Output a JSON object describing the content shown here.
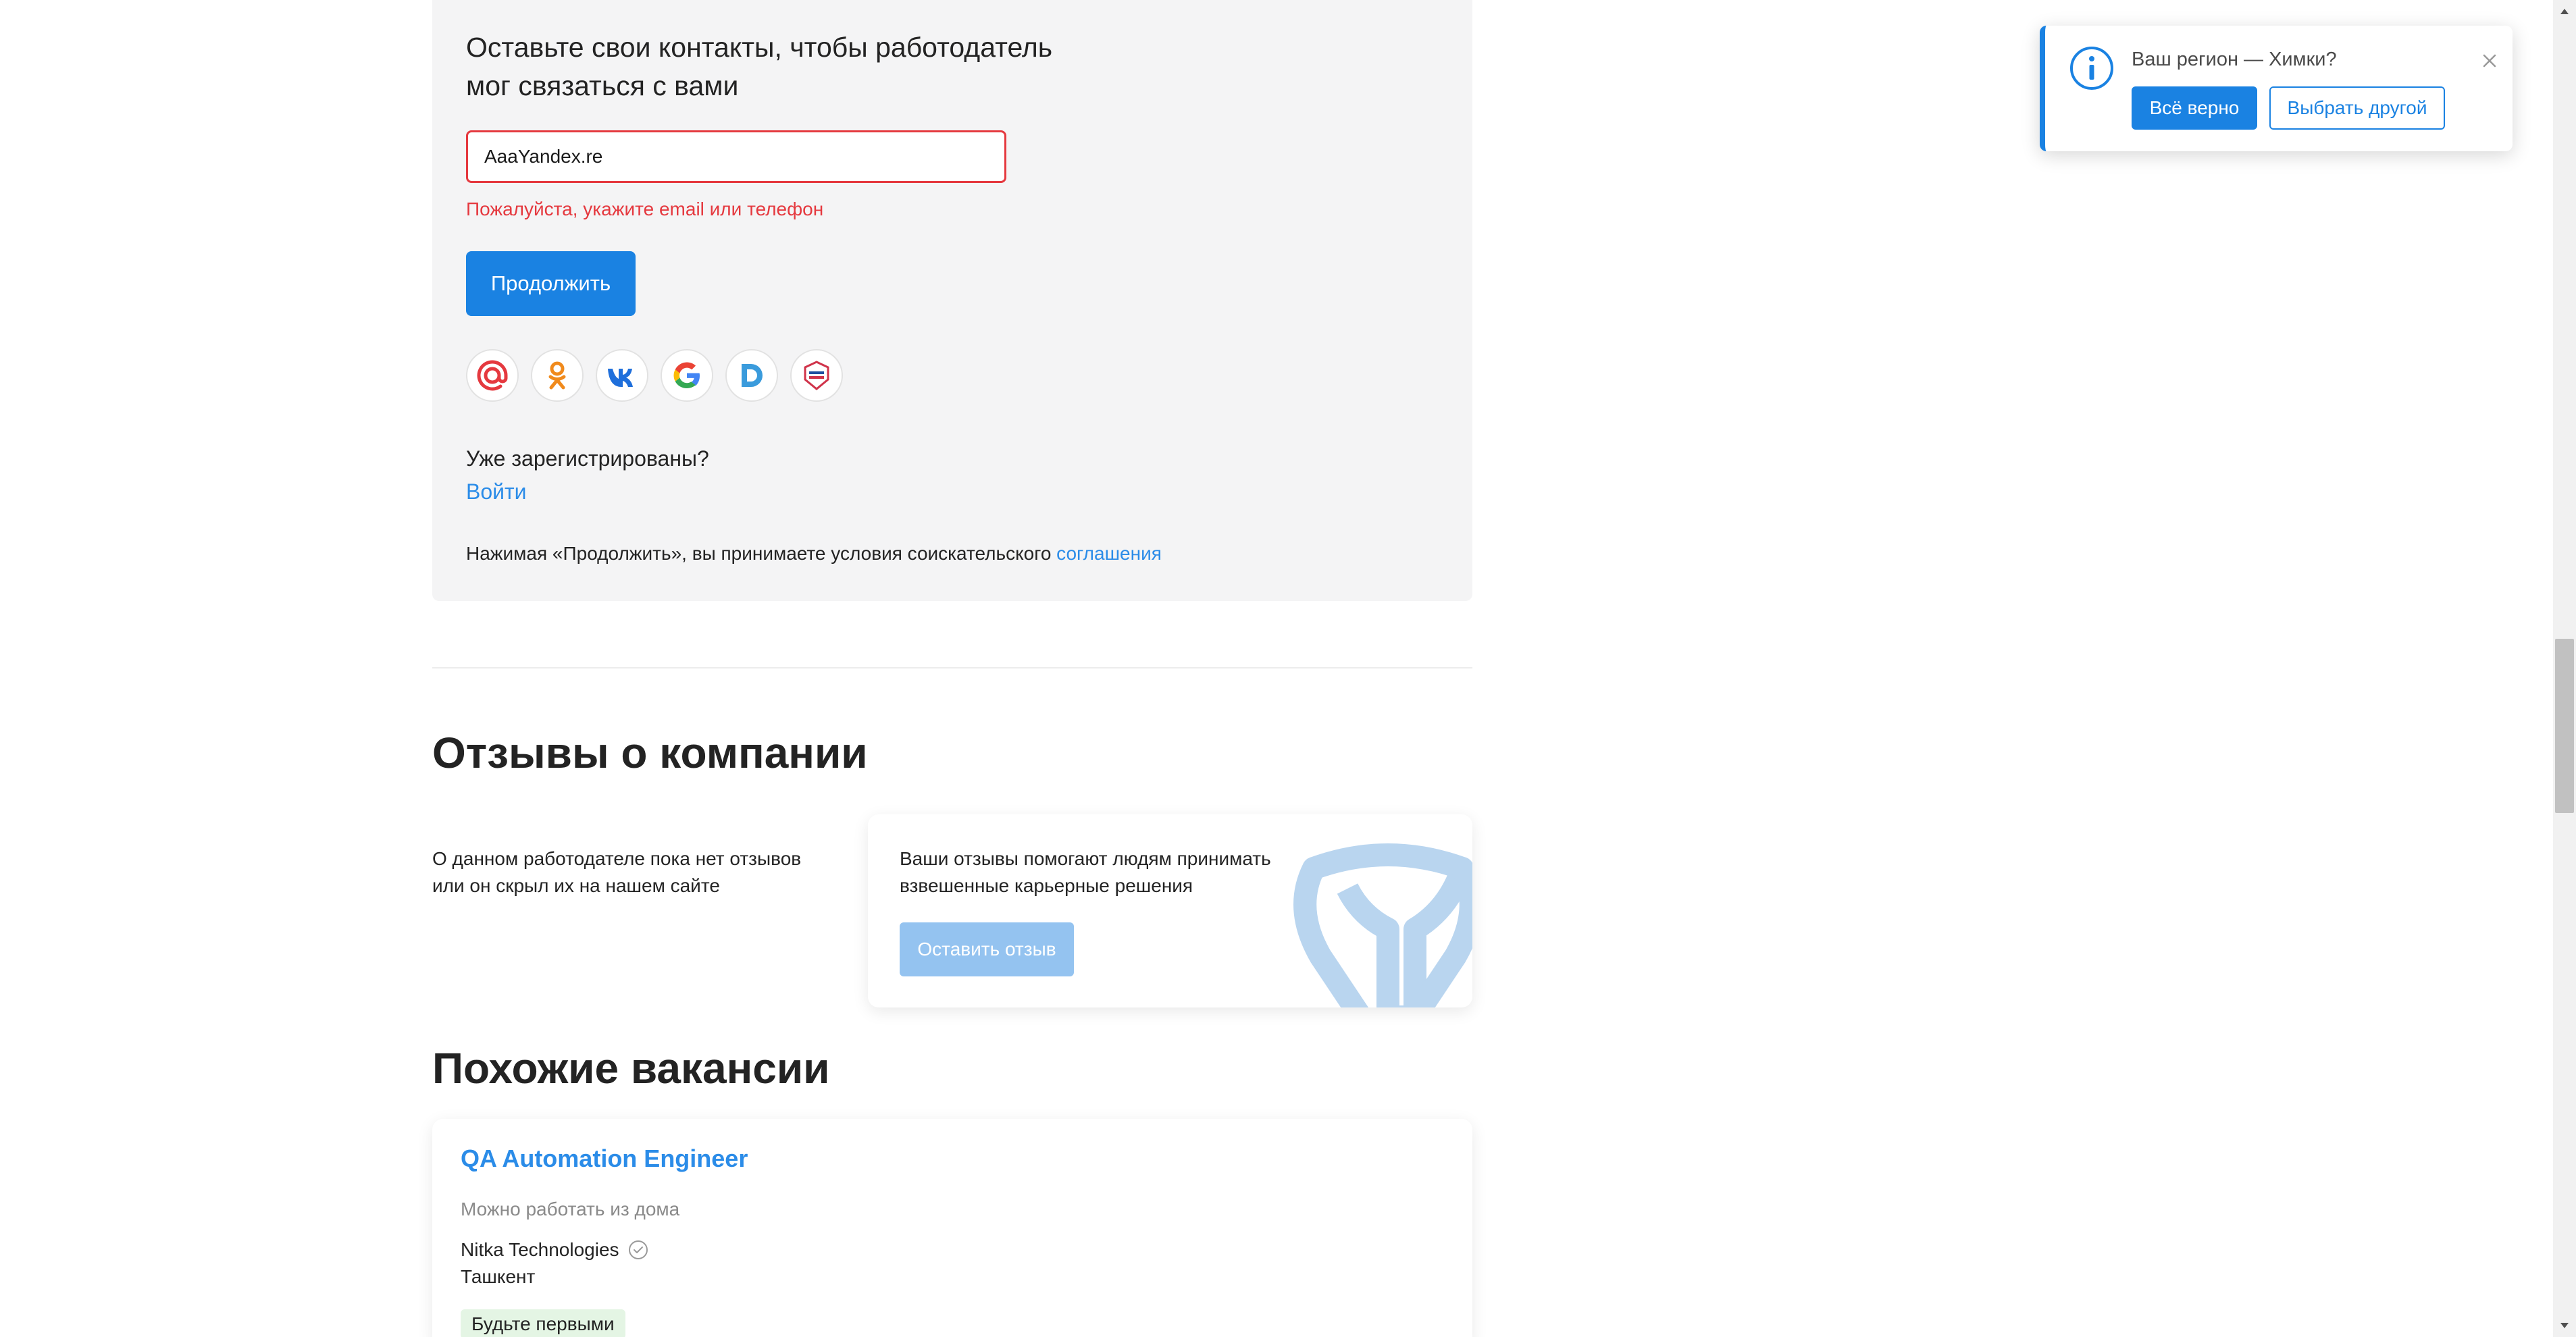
{
  "contact_form": {
    "title": "Оставьте свои контакты, чтобы работодатель мог связаться с вами",
    "input_value": "AaaYandex.re",
    "error_text": "Пожалуйста, укажите email или телефон",
    "continue_label": "Продолжить",
    "social_icons": [
      "mail-ru-icon",
      "odnoklassniki-icon",
      "vk-icon",
      "google-icon",
      "d-icon",
      "gosuslugi-icon"
    ],
    "already_registered": "Уже зарегистрированы?",
    "login_link": "Войти",
    "terms_prefix": "Нажимая «Продолжить», вы принимаете условия соискательского",
    "terms_link": "соглашения"
  },
  "reviews": {
    "heading": "Отзывы о компании",
    "empty_text": "О данном работодателе пока нет отзывов или он скрыл их на нашем сайте",
    "card_text": "Ваши отзывы помогают людям принимать взвешенные карьерные решения",
    "button_label": "Оставить отзыв"
  },
  "similar": {
    "heading": "Похожие вакансии",
    "vacancy": {
      "title": "QA Automation Engineer",
      "remote": "Можно работать из дома",
      "company": "Nitka Technologies",
      "city": "Ташкент",
      "badge": "Будьте первыми"
    }
  },
  "region_popup": {
    "question": "Ваш регион — Химки?",
    "confirm_label": "Всё верно",
    "other_label": "Выбрать другой"
  },
  "colors": {
    "primary": "#1a82e2",
    "link": "#2b8ce8",
    "error": "#e5393f",
    "badge_bg": "#e4f5e4",
    "card_bg": "#f4f4f5"
  }
}
